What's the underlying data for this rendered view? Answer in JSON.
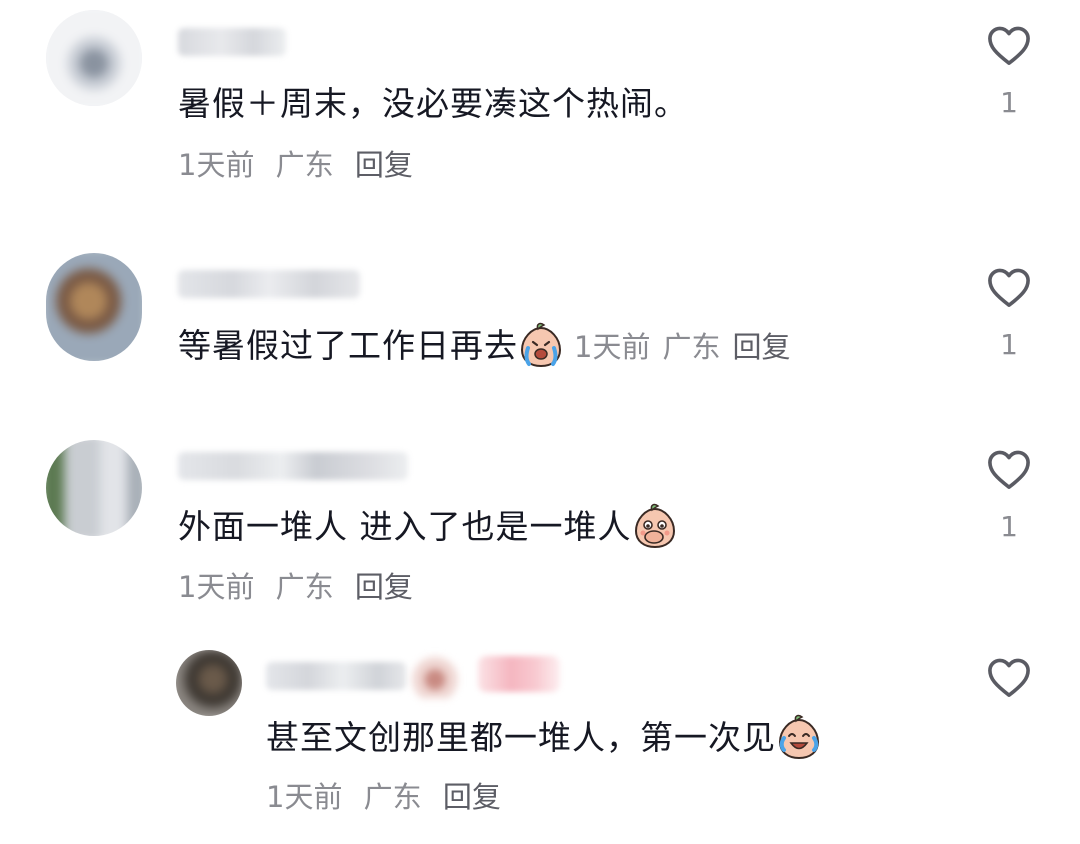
{
  "comments": [
    {
      "text": "暑假＋周末，没必要凑这个热闹。",
      "time": "1天前",
      "location": "广东",
      "reply": "回复",
      "likes": "1"
    },
    {
      "text": "等暑假过了工作日再去",
      "time": "1天前",
      "location": "广东",
      "reply": "回复",
      "likes": "1"
    },
    {
      "text": "外面一堆人 进入了也是一堆人",
      "time": "1天前",
      "location": "广东",
      "reply": "回复",
      "likes": "1"
    },
    {
      "text": "甚至文创那里都一堆人，第一次见",
      "time": "1天前",
      "location": "广东",
      "reply": "回复",
      "likes": ""
    }
  ],
  "icons": {
    "like": "heart-outline-icon",
    "emoji_crying": "peach-crying-emoji",
    "emoji_covering_mouth": "peach-covering-mouth-emoji",
    "emoji_laugh_cry": "peach-laugh-cry-emoji"
  },
  "colors": {
    "text": "#161823",
    "meta": "#8a8b91",
    "reply": "#5d5e66",
    "icon": "#5a5b63"
  }
}
